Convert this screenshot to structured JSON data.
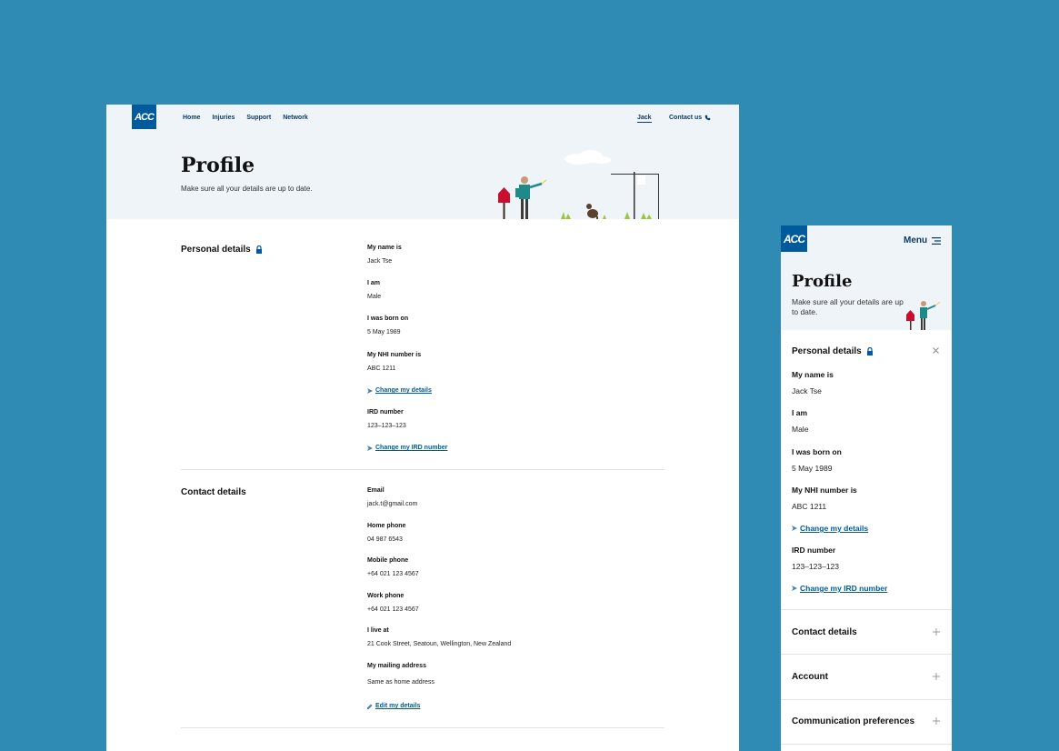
{
  "brand": {
    "logo_text": "ACC",
    "accent": "#005a9c",
    "nav_color": "#0d3b66",
    "background": "#2f8bb3",
    "hero_bg": "#eef4f8"
  },
  "desktop": {
    "nav": [
      "Home",
      "Injuries",
      "Support",
      "Network"
    ],
    "user": "Jack",
    "contact": "Contact us",
    "title": "Profile",
    "subtitle": "Make sure all your details are up to date.",
    "personal": {
      "title": "Personal details",
      "fields": [
        {
          "label": "My name is",
          "value": "Jack Tse"
        },
        {
          "label": "I am",
          "value": "Male"
        },
        {
          "label": "I was born on",
          "value": "5 May 1989"
        },
        {
          "label": "My NHI number is",
          "value": "ABC 1211"
        }
      ],
      "change_link": "Change my details",
      "ird": {
        "label": "IRD number",
        "value": "123–123–123"
      },
      "ird_link": "Change my IRD number"
    },
    "contact_details": {
      "title": "Contact details",
      "fields": [
        {
          "label": "Email",
          "value": "jack.t@gmail.com"
        },
        {
          "label": "Home phone",
          "value": "04 987 6543"
        },
        {
          "label": "Mobile phone",
          "value": "+64 021 123 4567"
        },
        {
          "label": "Work phone",
          "value": "+64 021 123 4567"
        },
        {
          "label": "I live at",
          "value": "21 Cook Street, Seatoun, Wellington, New Zealand"
        },
        {
          "label": "My mailing address",
          "value": "Same as home address"
        }
      ],
      "edit_link": "Edit my details"
    }
  },
  "mobile": {
    "menu": "Menu",
    "title": "Profile",
    "subtitle": "Make sure all your details are up to date.",
    "personal": {
      "title": "Personal details",
      "fields": [
        {
          "label": "My name is",
          "value": "Jack Tse"
        },
        {
          "label": "I am",
          "value": "Male"
        },
        {
          "label": "I was born on",
          "value": "5 May 1989"
        },
        {
          "label": "My NHI number is",
          "value": "ABC 1211"
        }
      ],
      "change_link": "Change my details",
      "ird": {
        "label": "IRD number",
        "value": "123–123–123"
      },
      "ird_link": "Change my IRD number"
    },
    "sections": [
      "Contact details",
      "Account",
      "Communication preferences"
    ]
  }
}
